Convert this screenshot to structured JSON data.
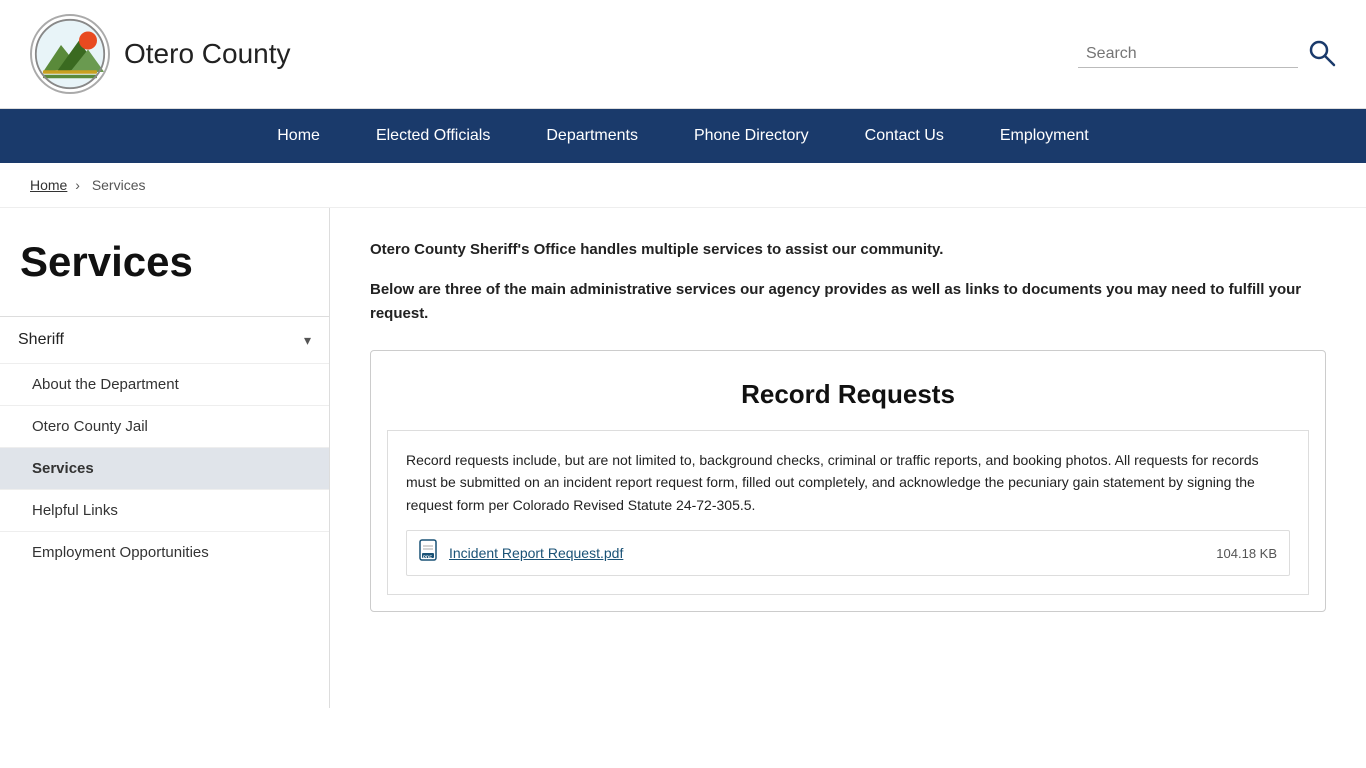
{
  "header": {
    "site_title": "Otero County",
    "search_placeholder": "Search"
  },
  "nav": {
    "items": [
      {
        "label": "Home",
        "key": "home"
      },
      {
        "label": "Elected Officials",
        "key": "elected-officials"
      },
      {
        "label": "Departments",
        "key": "departments"
      },
      {
        "label": "Phone Directory",
        "key": "phone-directory"
      },
      {
        "label": "Contact Us",
        "key": "contact-us"
      },
      {
        "label": "Employment",
        "key": "employment"
      }
    ]
  },
  "breadcrumb": {
    "home_label": "Home",
    "separator": "›",
    "current": "Services"
  },
  "sidebar": {
    "title": "Services",
    "section_label": "Sheriff",
    "sub_items": [
      {
        "label": "About the Department",
        "key": "about",
        "active": false
      },
      {
        "label": "Otero County Jail",
        "key": "jail",
        "active": false
      },
      {
        "label": "Services",
        "key": "services",
        "active": true
      },
      {
        "label": "Helpful Links",
        "key": "helpful-links",
        "active": false
      },
      {
        "label": "Employment Opportunities",
        "key": "employment",
        "active": false
      }
    ]
  },
  "content": {
    "intro1": "Otero County Sheriff's Office handles multiple services to assist our community.",
    "intro2": "Below are three of the main administrative services our agency provides as well as links to documents you may need to fulfill your request.",
    "card_title": "Record Requests",
    "card_text": "Record requests include, but are not limited to, background checks, criminal or traffic reports, and booking photos. All requests for records must be submitted on an incident report request form, filled out completely, and acknowledge the pecuniary gain statement by signing the request form per Colorado Revised Statute 24-72-305.5.",
    "file_label": "Incident Report Request.pdf",
    "file_size": "104.18 KB"
  },
  "colors": {
    "nav_bg": "#1a3a6b",
    "active_sidebar": "#e0e4ea",
    "link_color": "#1a5276"
  }
}
